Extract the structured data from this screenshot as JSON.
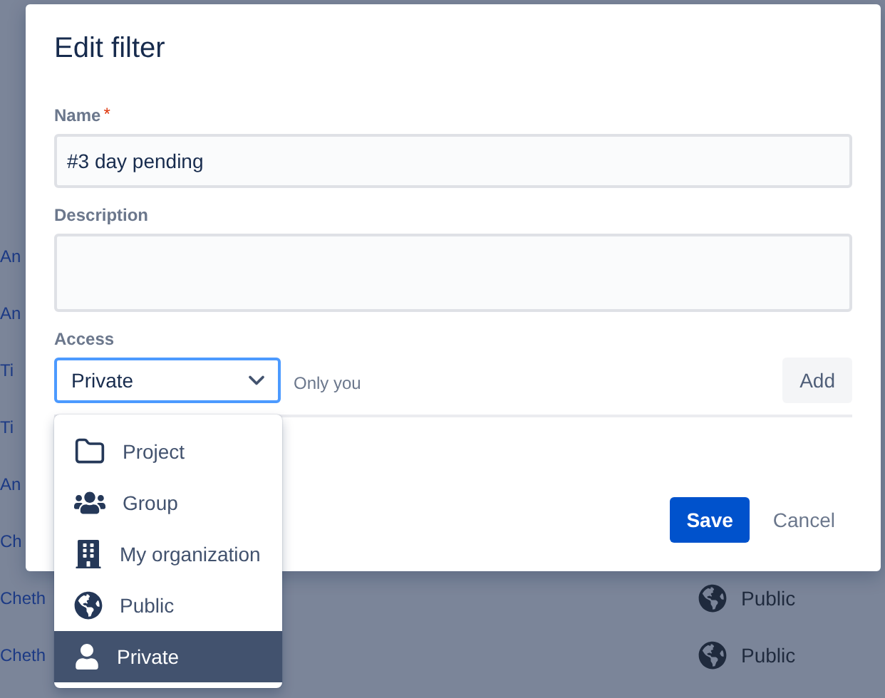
{
  "background_rows": [
    {
      "name": "An"
    },
    {
      "name": "An"
    },
    {
      "name": "Ti"
    },
    {
      "name": "Ti"
    },
    {
      "name": "An"
    },
    {
      "name": "Ch"
    },
    {
      "name": "Cheth",
      "access": "Public"
    },
    {
      "name": "Cheth",
      "access": "Public"
    }
  ],
  "dialog": {
    "title": "Edit filter",
    "fields": [
      {
        "kind": "text",
        "label": "Name",
        "required_mark": "*",
        "value": "#3 day pending"
      },
      {
        "kind": "textarea",
        "label": "Description"
      }
    ],
    "access": {
      "label": "Access",
      "value": "Private",
      "hint": "Only you",
      "add_button": "Add",
      "dropdown": {
        "expanded": true,
        "options": [
          {
            "kind": "project",
            "label": "Project",
            "selected": false
          },
          {
            "kind": "group",
            "label": "Group",
            "selected": false
          },
          {
            "kind": "organization",
            "label": "My organization",
            "selected": false
          },
          {
            "kind": "public",
            "label": "Public",
            "selected": false
          },
          {
            "kind": "private",
            "label": "Private",
            "selected": true
          }
        ]
      }
    },
    "buttons": [
      {
        "kind": "primary",
        "label": "Save"
      },
      {
        "kind": "subtle",
        "label": "Cancel"
      }
    ]
  }
}
